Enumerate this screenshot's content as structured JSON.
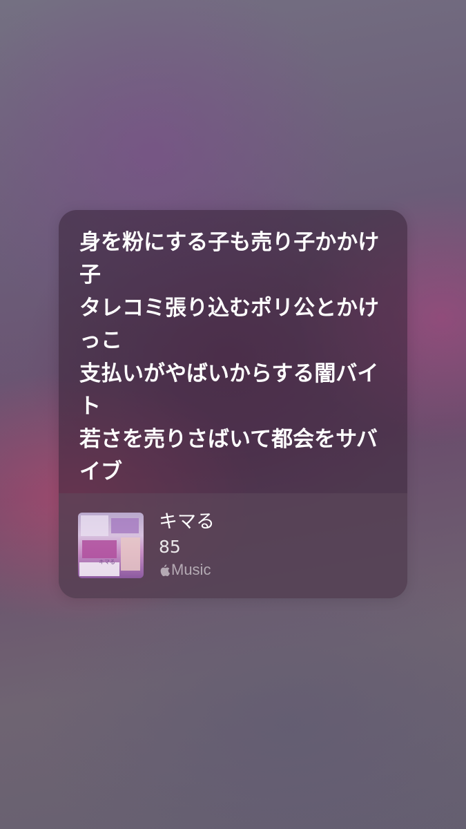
{
  "lyrics": [
    "身を粉にする子も売り子かかけ子",
    "タレコミ張り込むポリ公とかけっこ",
    "支払いがやばいからする闇バイト",
    "若さを売りさばいて都会をサバイブ"
  ],
  "track": {
    "title": "キマる",
    "artist": "85",
    "service_label": "Music",
    "service_icon": "apple-logo-icon",
    "artwork_text": "キマる"
  }
}
